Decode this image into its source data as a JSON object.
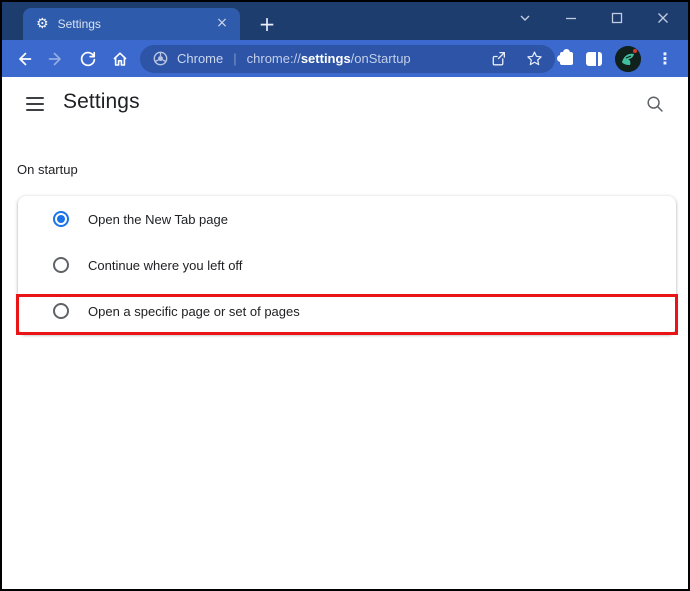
{
  "colors": {
    "titlebar": "#1e3d6f",
    "active_tab": "#2e5bab",
    "toolbar": "#3b69cd",
    "omnibox": "#2d54a6",
    "accent_blue": "#1a73e8",
    "annotation_red": "#e81416"
  },
  "titlebar": {
    "tab_title": "Settings",
    "gear_glyph": "⚙",
    "tab_close_glyph": "×",
    "new_tab_glyph": "+"
  },
  "toolbar": {
    "site_label": "Chrome",
    "separator": "|",
    "url": {
      "scheme": "chrome://",
      "highlight": "settings",
      "path": "/onStartup"
    },
    "overflow_glyph": "⋮"
  },
  "page": {
    "title": "Settings",
    "section_label": "On startup",
    "options": [
      {
        "label": "Open the New Tab page",
        "selected": true,
        "annotated": false
      },
      {
        "label": "Continue where you left off",
        "selected": false,
        "annotated": false
      },
      {
        "label": "Open a specific page or set of pages",
        "selected": false,
        "annotated": true
      }
    ]
  }
}
